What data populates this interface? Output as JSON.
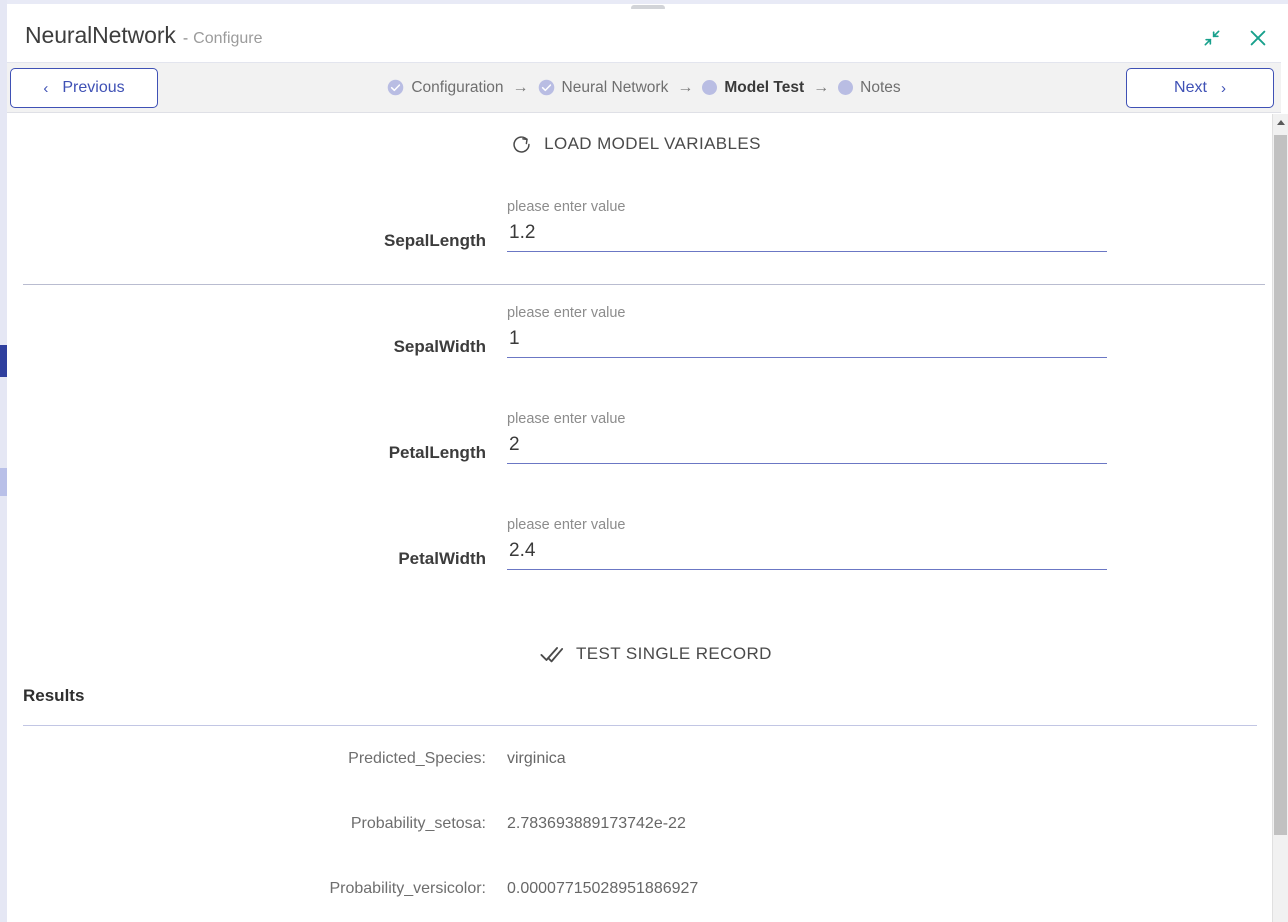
{
  "window": {
    "title": "NeuralNetwork",
    "title_separator": "-",
    "subtitle": "Configure",
    "drag_handle": "drag-handle",
    "actions": {
      "minimize_label": "collapse",
      "close_label": "close"
    }
  },
  "nav": {
    "previous_label": "Previous",
    "previous_chevron": "‹",
    "next_label": "Next",
    "next_chevron": "›",
    "arrow": "→",
    "steps": [
      {
        "label": "Configuration",
        "state": "complete",
        "icon": "check-circle-icon"
      },
      {
        "label": "Neural Network",
        "state": "complete",
        "icon": "check-circle-icon"
      },
      {
        "label": "Model Test",
        "state": "active",
        "icon": "dot-icon"
      },
      {
        "label": "Notes",
        "state": "pending",
        "icon": "dot-icon"
      }
    ]
  },
  "main": {
    "load_button_label": "LOAD MODEL VARIABLES",
    "load_button_icon": "refresh-icon",
    "test_button_label": "TEST SINGLE RECORD",
    "test_button_icon": "done-all-icon",
    "fields": [
      {
        "label": "SepalLength",
        "hint": "please enter value",
        "value": "1.2"
      },
      {
        "label": "SepalWidth",
        "hint": "please enter value",
        "value": "1"
      },
      {
        "label": "PetalLength",
        "hint": "please enter value",
        "value": "2"
      },
      {
        "label": "PetalWidth",
        "hint": "please enter value",
        "value": "2.4"
      }
    ],
    "results_title": "Results",
    "results": [
      {
        "label": "Predicted_Species:",
        "value": "virginica"
      },
      {
        "label": "Probability_setosa:",
        "value": "2.783693889173742e-22"
      },
      {
        "label": "Probability_versicolor:",
        "value": "0.00007715028951886927"
      }
    ]
  },
  "colors": {
    "accent_blue": "#3f51b5",
    "accent_teal": "#18a08c",
    "step_complete": "#b9bde3",
    "underline": "#6b77c4",
    "navbar_bg": "#f2f2f2"
  }
}
